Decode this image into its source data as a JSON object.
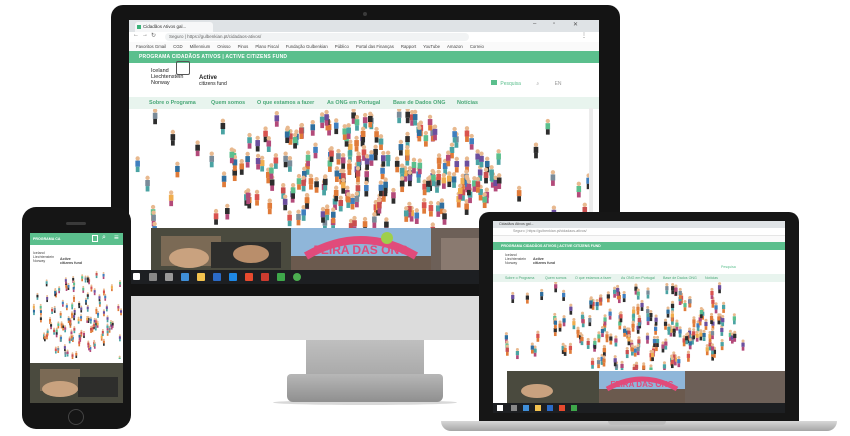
{
  "browser": {
    "tab_title": "Cidadãos Ativos gal...",
    "url": "Seguro | https://gulbenkian.pt/cidadaos-ativos/",
    "bookmarks": [
      "Favoritos Gmail",
      "CGD",
      "Millennium",
      "Onisso",
      "Pinos",
      "Plano Fiscal",
      "Fundação Gulbenkian",
      "Público",
      "Portal das Finanças",
      "Rapport",
      "YouTube",
      "Amazon",
      "Correio"
    ]
  },
  "site": {
    "top_title": "PROGRAMA CIDADÃOS ATIVOS | ACTIVE CITIZENS FUND",
    "logo_lines": [
      "Iceland",
      "Liechtenstein",
      "Norway"
    ],
    "active_lines": [
      "Active",
      "citizens fund"
    ],
    "header_right": "Pesquisa",
    "header_lang": "EN",
    "nav": [
      "Sobre o Programa",
      "Quem somos",
      "O que estamos a fazer",
      "As ONG em Portugal",
      "Base de Dados ONG",
      "Notícias"
    ],
    "banner_text": "FEIRA DAS ONG"
  },
  "phone": {
    "top_title": "PROGRAMA CA",
    "logo_lines": [
      "Iceland",
      "Liechtenstein",
      "Norway"
    ],
    "active_lines": [
      "Active",
      "citizens fund"
    ]
  },
  "colors": {
    "brand_green": "#5bbf8d",
    "nav_bg": "#e8f4ee",
    "bezel": "#141414",
    "taskbar": "#1d1f22"
  }
}
